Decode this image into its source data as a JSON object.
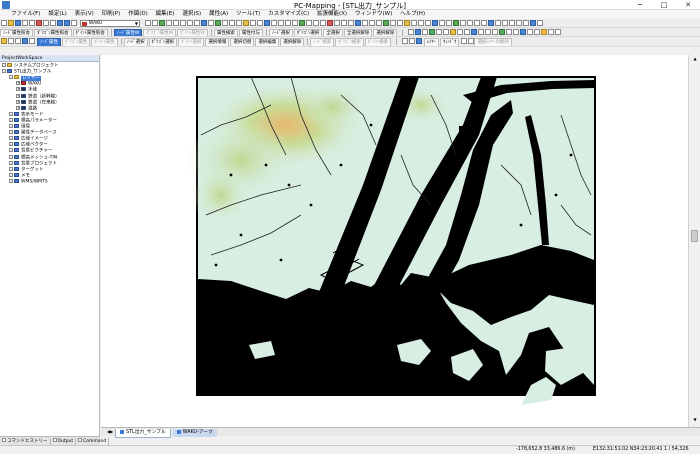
{
  "window": {
    "title": "PC-Mapping - [STL出力_サンプル]",
    "minimize": "─",
    "maximize": "□",
    "close": "✕"
  },
  "menu": [
    "ファイル(F)",
    "設定(L)",
    "表示(V)",
    "印刷(P)",
    "作図(D)",
    "編集(E)",
    "選択(S)",
    "属性(A)",
    "ツール(T)",
    "カスタマイズ(C)",
    "拡張機能(X)",
    "ウィンドウ(W)",
    "ヘルプ(H)"
  ],
  "toolbar1": {
    "layer_combo": "WAKU"
  },
  "toolbar2": {
    "buttons": [
      "ﾉｰﾄﾞ属性照会",
      "ﾎﾟﾘｺﾞﾝ属性照会",
      "ﾎﾟｲﾝﾄ属性照会",
      "ﾉｰﾄﾞ属性W",
      "ﾎﾟﾘｺﾞﾝ属性W",
      "ﾎﾟｲﾝﾄ属性W",
      "属性検索",
      "属性付与",
      "ﾉｰﾄﾞ選択",
      "ﾎﾟﾘｺﾞﾝ選択",
      "全選択",
      "全選択解除",
      "選択解除"
    ]
  },
  "toolbar3": {
    "buttons": [
      "ﾉｰﾄﾞ属性",
      "ﾎﾟﾘｺﾞﾝ属性",
      "ﾎﾟｲﾝﾄ属性",
      "ﾉｰﾄﾞ選択",
      "ﾎﾟﾘｺﾞﾝ選択",
      "ﾎﾟｲﾝﾄ選択",
      "選択情報",
      "選択切替",
      "選択編集",
      "選択解除",
      "ﾉｰﾄﾞ検索",
      "ﾎﾟﾘｺﾞﾝ検索",
      "ﾎﾟｲﾝﾄ検索"
    ],
    "right_buttons": [
      "ﾚｲﾔｰ",
      "ｳｨﾝﾄﾞｳ",
      "選択ﾚｲﾔｰの解除"
    ]
  },
  "left_panel": {
    "title": "ProjectWorkSpace",
    "tree": [
      {
        "label": "システムプロジェクト",
        "depth": 0,
        "icon": "folder"
      },
      {
        "label": "STL出力_サンプル",
        "depth": 0,
        "icon": "map"
      },
      {
        "label": "レイヤー",
        "depth": 1,
        "icon": "folder",
        "selected": true
      },
      {
        "label": "WAKU",
        "depth": 2,
        "icon": "red"
      },
      {
        "label": "水域",
        "depth": 2,
        "icon": "lines"
      },
      {
        "label": "鉄道（新幹線）",
        "depth": 2,
        "icon": "lines"
      },
      {
        "label": "鉄道（在来線）",
        "depth": 2,
        "icon": "lines"
      },
      {
        "label": "道路",
        "depth": 2,
        "icon": "lines"
      },
      {
        "label": "表示モード",
        "depth": 1,
        "icon": "map"
      },
      {
        "label": "標高パラメーター",
        "depth": 1,
        "icon": "map"
      },
      {
        "label": "環境",
        "depth": 1,
        "icon": "map"
      },
      {
        "label": "属性データベース",
        "depth": 1,
        "icon": "map"
      },
      {
        "label": "広域イメージ",
        "depth": 1,
        "icon": "map"
      },
      {
        "label": "広域ベクター",
        "depth": 1,
        "icon": "map"
      },
      {
        "label": "背景ビクチャー",
        "depth": 1,
        "icon": "map"
      },
      {
        "label": "標高メッシュ-TIN",
        "depth": 1,
        "icon": "map"
      },
      {
        "label": "背景プロジェクト",
        "depth": 1,
        "icon": "map"
      },
      {
        "label": "ターゲット",
        "depth": 1,
        "icon": "map"
      },
      {
        "label": "メモ",
        "depth": 1,
        "icon": "map"
      },
      {
        "label": "WMS/WMTS",
        "depth": 1,
        "icon": "map"
      }
    ],
    "tabs": [
      "コマンドヒストリー",
      "Output",
      "Command"
    ]
  },
  "map_tabs": [
    {
      "label": "STL出力_サンプル",
      "active": true
    },
    {
      "label": "WAKU-アーク",
      "active": false
    }
  ],
  "status": {
    "coords": "-178,652.8  33,486.6 (m)",
    "geo": "E132:31:51.02  N34:23:20.41",
    "scale": "1 / 54,326"
  }
}
